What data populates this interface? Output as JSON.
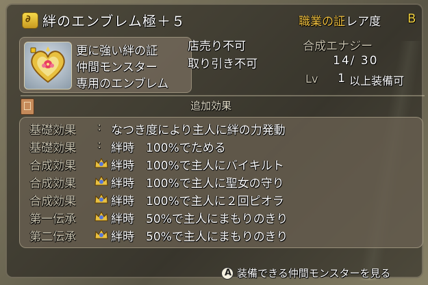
{
  "header": {
    "item_icon": "emblem-coin-icon",
    "item_icon_glyph": "∂",
    "emblem_name": "絆のエンブレム極＋５",
    "proof_label": "職業の証",
    "rarity_label": "レア度",
    "rarity_value": "B"
  },
  "description": {
    "portrait_icon": "heart-emblem-icon",
    "lines": [
      "更に強い絆の証",
      "仲間モンスター",
      "専用のエンブレム"
    ]
  },
  "properties": {
    "sell": "店売り不可",
    "trade": "取り引き不可",
    "energy_label": "合成エナジー",
    "energy_value": "14/ 30",
    "level_label": "Lv",
    "level_value": "1",
    "level_suffix": "以上装備可"
  },
  "section_title": "追加効果",
  "section_icon": "book-icon",
  "effects": [
    {
      "label": "基礎効果",
      "colon": ":",
      "crown": false,
      "text": "なつき度により主人に絆の力発動"
    },
    {
      "label": "基礎効果",
      "colon": ":",
      "crown": false,
      "text": "絆時　100%でためる"
    },
    {
      "label": "合成効果",
      "colon": "",
      "crown": true,
      "text": "絆時　100%で主人にバイキルト"
    },
    {
      "label": "合成効果",
      "colon": "",
      "crown": true,
      "text": "絆時　100%で主人に聖女の守り"
    },
    {
      "label": "合成効果",
      "colon": "",
      "crown": true,
      "text": "絆時　100%で主人に２回ピオラ"
    },
    {
      "label": "第一伝承",
      "colon": "",
      "crown": true,
      "text": "絆時　50%で主人にまもりのきり"
    },
    {
      "label": "第二伝承",
      "colon": "",
      "crown": true,
      "text": "絆時　50%で主人にまもりのきり"
    }
  ],
  "footer": {
    "button_glyph": "A",
    "action_label": "装備できる仲間モンスターを見る"
  },
  "colors": {
    "gold": "#f0c040",
    "rarity": "#f0d040",
    "panel": "#6e6455"
  }
}
